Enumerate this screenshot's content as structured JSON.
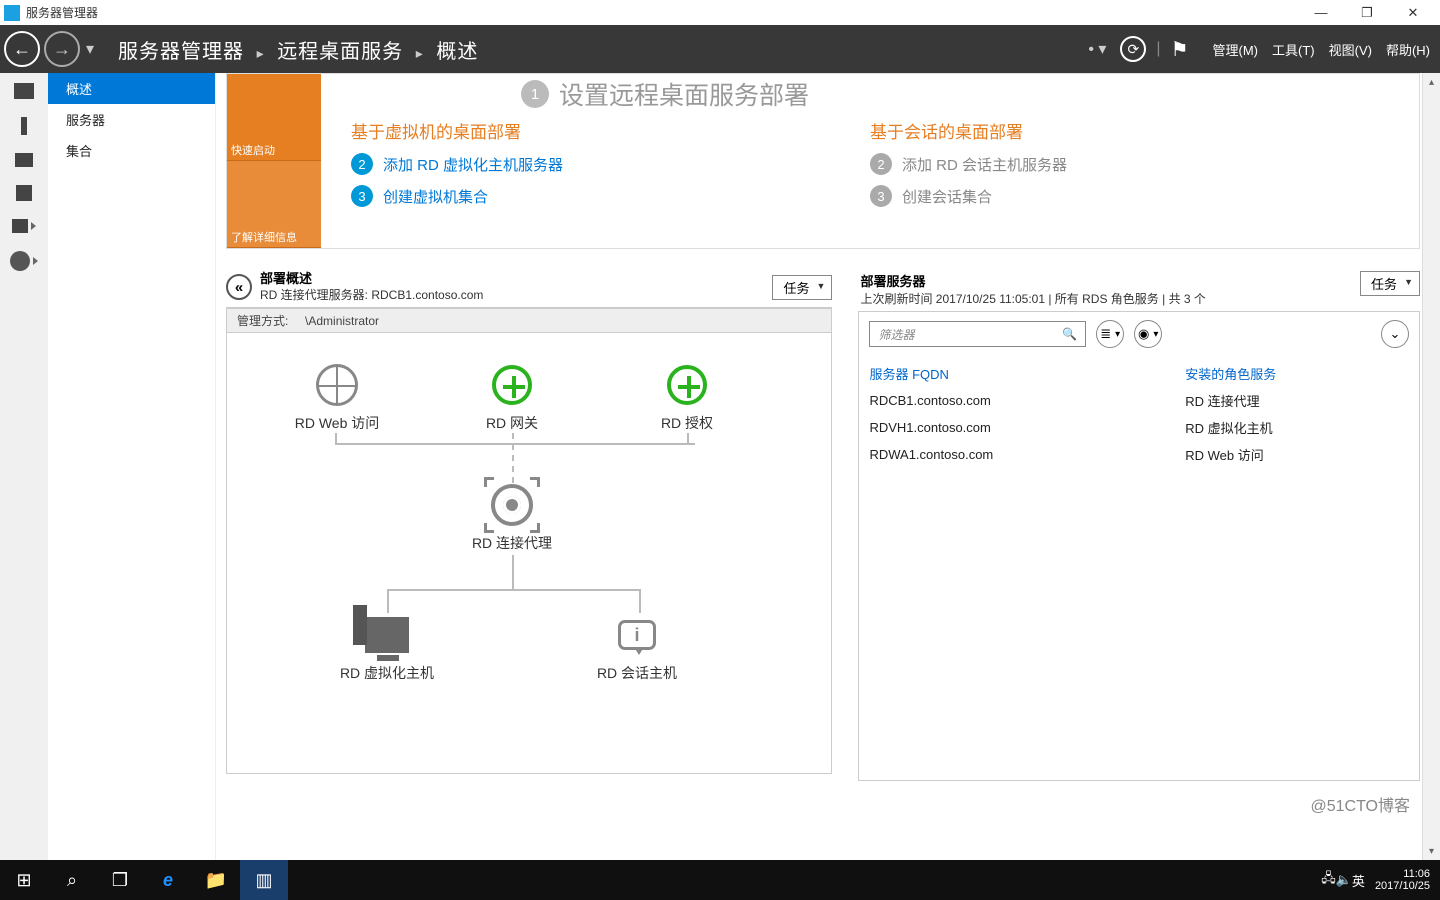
{
  "window": {
    "title": "服务器管理器",
    "minimize": "—",
    "maximize": "❐",
    "close": "✕"
  },
  "toolbar": {
    "bc1": "服务器管理器",
    "bc2": "远程桌面服务",
    "bc3": "概述",
    "sep": "▸",
    "drop": "▾",
    "refresh": "⟳",
    "pipe": "|",
    "flag": "⚑",
    "menus": {
      "manage": "管理(M)",
      "tools": "工具(T)",
      "view": "视图(V)",
      "help": "帮助(H)"
    }
  },
  "sidebar": {
    "overview": "概述",
    "servers": "服务器",
    "collections": "集合"
  },
  "wizard": {
    "tile_top": "快速启动",
    "tile_bot": "了解详细信息",
    "title_num": "1",
    "title": "设置远程桌面服务部署",
    "left": {
      "title": "基于虚拟机的桌面部署",
      "step2": "添加 RD 虚拟化主机服务器",
      "step3": "创建虚拟机集合"
    },
    "right": {
      "title": "基于会话的桌面部署",
      "step2": "添加 RD 会话主机服务器",
      "step3": "创建会话集合"
    },
    "n2": "2",
    "n3": "3"
  },
  "deployL": {
    "title": "部署概述",
    "sub": "RD 连接代理服务器: RDCB1.contoso.com",
    "tasks": "任务",
    "manage_label": "管理方式:",
    "manage_val": "\\Administrator",
    "arrow": "«",
    "nodes": {
      "web": "RD Web 访问",
      "gw": "RD 网关",
      "lic": "RD 授权",
      "broker": "RD 连接代理",
      "vh": "RD 虚拟化主机",
      "sess": "RD 会话主机"
    }
  },
  "deployR": {
    "title": "部署服务器",
    "meta": "上次刷新时间 2017/10/25 11:05:01 | 所有 RDS 角色服务  | 共 3 个",
    "tasks": "任务",
    "filter_ph": "筛选器",
    "mag": "🔍",
    "list_ico": "≣",
    "disk_ico": "◉",
    "expand": "⌄",
    "col_fqdn": "服务器 FQDN",
    "col_role": "安装的角色服务",
    "rows": [
      {
        "fqdn": "RDCB1.contoso.com",
        "role": "RD 连接代理"
      },
      {
        "fqdn": "RDVH1.contoso.com",
        "role": "RD 虚拟化主机"
      },
      {
        "fqdn": "RDWA1.contoso.com",
        "role": "RD Web 访问"
      }
    ]
  },
  "taskbar": {
    "start": "⊞",
    "search": "⌕",
    "tasks": "❐",
    "ie": "e",
    "explorer": "📁",
    "sm": "▥",
    "net": "🖧",
    "vol": "🔈",
    "ime": "英",
    "time": "11:06",
    "date": "2017/10/25"
  },
  "watermark": "@51CTO博客"
}
